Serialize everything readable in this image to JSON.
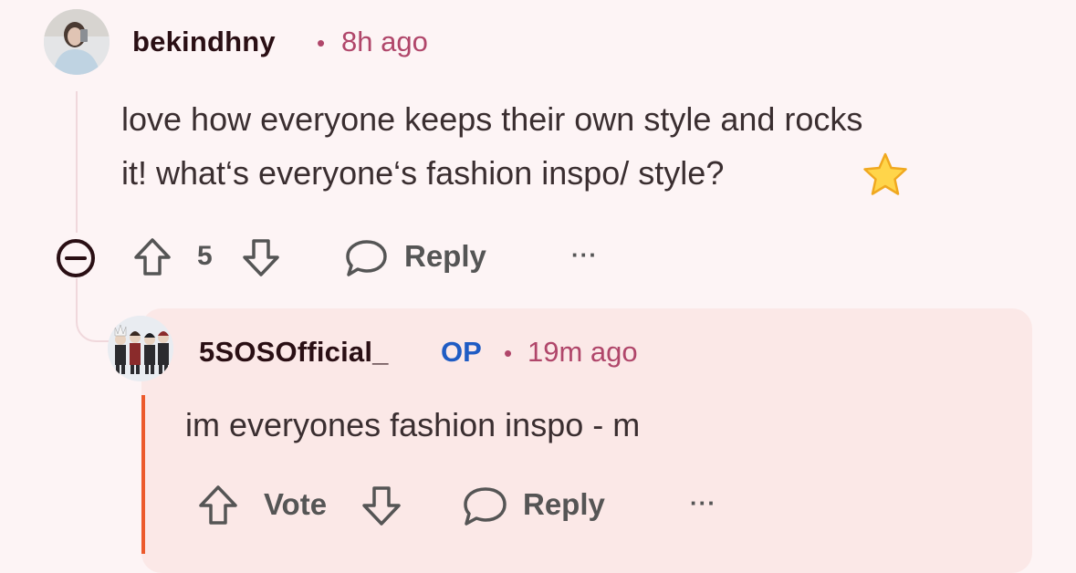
{
  "comment": {
    "username": "bekindhny",
    "separator": "•",
    "time": "8h ago",
    "body_line1": "love how everyone keeps their own style and rocks",
    "body_line2": "it! what‘s everyone‘s fashion inspo/ style?",
    "emoji": "⭐",
    "vote_count": "5",
    "reply_label": "Reply",
    "more_label": "···",
    "collapse_icon": "collapse-minus-icon"
  },
  "reply": {
    "username": "5SOSOfficial_",
    "op_badge": "OP",
    "separator": "•",
    "time": "19m ago",
    "body": "im everyones fashion inspo - m",
    "vote_label": "Vote",
    "reply_label": "Reply",
    "more_label": "···"
  },
  "colors": {
    "background": "#fdf4f5",
    "reply_card": "#fbe8e7",
    "accent_bar": "#ec5a2c",
    "time_text": "#b0466a",
    "op_badge": "#1f5cc4"
  }
}
